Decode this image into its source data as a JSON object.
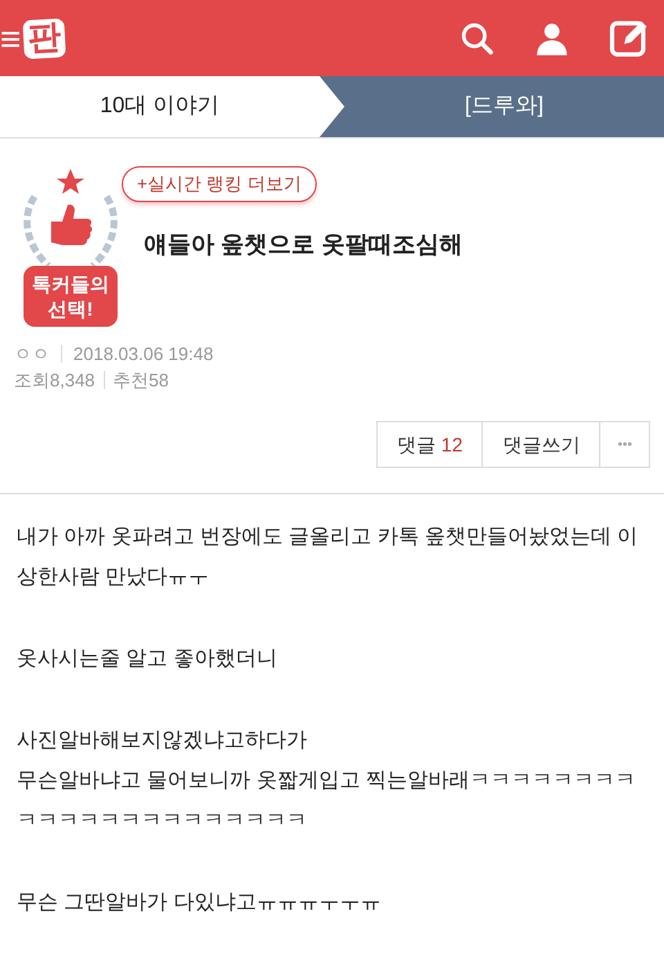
{
  "header": {
    "logo": "판",
    "menu_icon": "≡"
  },
  "breadcrumb": [
    {
      "label": "10대 이야기",
      "selected": false
    },
    {
      "label": "[드루와]",
      "selected": true
    }
  ],
  "post": {
    "ranking_link": "+실시간 랭킹 더보기",
    "badge": [
      "톡커들의",
      "선택!"
    ],
    "title": "얘들아 옾챗으로 옷팔때조심해",
    "author": "ㅇㅇ",
    "date": "2018.03.06 19:48",
    "views": "조회8,348",
    "likes": "추천58",
    "actions": {
      "comments_label": "댓글",
      "comments_count": "12",
      "write": "댓글쓰기",
      "more": "•••"
    }
  },
  "body": [
    [
      "내가 아까 옷파려고 번장에도 글올리고 카톡 옾챗만들어놨었는데 이상한사람 만났다ㅠㅜ"
    ],
    [
      "옷사시는줄 알고 좋아했더니"
    ],
    [
      "사진알바해보지않겠냐고하다가",
      "무슨알바냐고 물어보니까 옷짧게입고 찍는알바래ㅋㅋㅋㅋㅋㅋㅋㅋㅋㅋㅋㅋㅋㅋㅋㅋㅋㅋㅋㅋㅋㅋ"
    ],
    [
      "무슨 그딴알바가 다있냐고ㅠㅠㅠㅜㅜㅠ"
    ]
  ]
}
